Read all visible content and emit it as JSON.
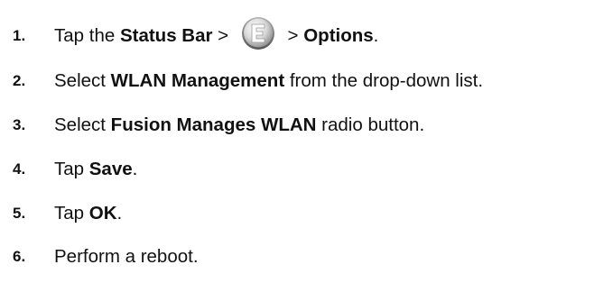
{
  "steps": [
    {
      "number": "1.",
      "parts": {
        "a": "Tap the ",
        "b": "Status Bar",
        "c": " > ",
        "icon": "fusion-e-icon",
        "d": " > ",
        "e": "Options",
        "f": "."
      }
    },
    {
      "number": "2.",
      "parts": {
        "a": "Select ",
        "b": "WLAN Management",
        "c": " from the drop-down list."
      }
    },
    {
      "number": "3.",
      "parts": {
        "a": "Select ",
        "b": "Fusion Manages WLAN",
        "c": " radio button."
      }
    },
    {
      "number": "4.",
      "parts": {
        "a": "Tap ",
        "b": "Save",
        "c": "."
      }
    },
    {
      "number": "5.",
      "parts": {
        "a": "Tap ",
        "b": "OK",
        "c": "."
      }
    },
    {
      "number": "6.",
      "parts": {
        "a": "Perform a reboot."
      }
    }
  ]
}
